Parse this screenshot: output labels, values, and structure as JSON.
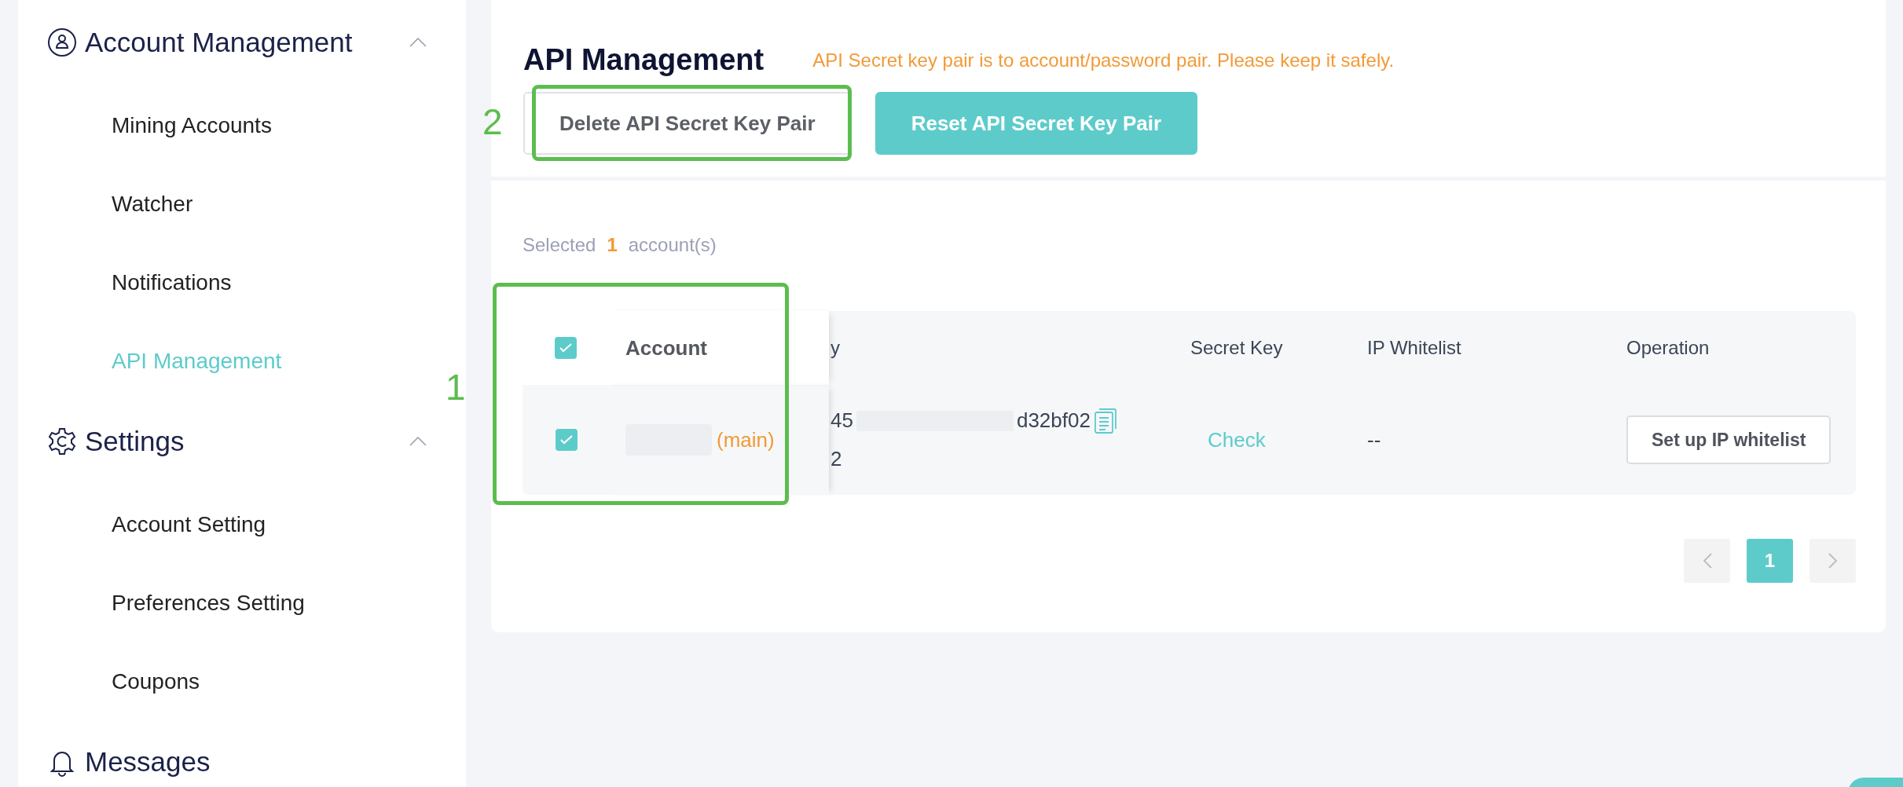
{
  "sidebar": {
    "groups": [
      {
        "title": "Account Management",
        "expanded": true,
        "items": [
          {
            "label": "Mining Accounts",
            "selected": false
          },
          {
            "label": "Watcher",
            "selected": false
          },
          {
            "label": "Notifications",
            "selected": false
          },
          {
            "label": "API Management",
            "selected": true
          }
        ]
      },
      {
        "title": "Settings",
        "expanded": true,
        "items": [
          {
            "label": "Account Setting",
            "selected": false
          },
          {
            "label": "Preferences Setting",
            "selected": false
          },
          {
            "label": "Coupons",
            "selected": false
          }
        ]
      },
      {
        "title": "Messages"
      }
    ]
  },
  "main": {
    "title": "API Management",
    "notice": "API Secret key pair is to account/password pair. Please keep it safely.",
    "buttons": [
      {
        "label": "Delete API Secret Key Pair",
        "kind": "outline"
      },
      {
        "label": "Reset API Secret Key Pair",
        "kind": "primary"
      }
    ],
    "selection": {
      "prefix": "Selected",
      "count": "1",
      "suffix": "account(s)"
    },
    "table": {
      "all_checked": true,
      "columns": [
        "Account",
        "y",
        "Secret Key",
        "IP Whitelist",
        "Operation"
      ],
      "rows": [
        {
          "checked": true,
          "account_tag": "(main)",
          "key_start": "45",
          "key_end": "d32bf02",
          "key_line2": "2",
          "secret_key": "Check",
          "ip_whitelist": "--",
          "operation": "Set up IP whitelist"
        }
      ]
    },
    "pagination": {
      "pages": [
        {
          "label": "1",
          "selected": true
        }
      ]
    }
  },
  "annotations": [
    {
      "label": "2"
    },
    {
      "label": "1"
    }
  ]
}
